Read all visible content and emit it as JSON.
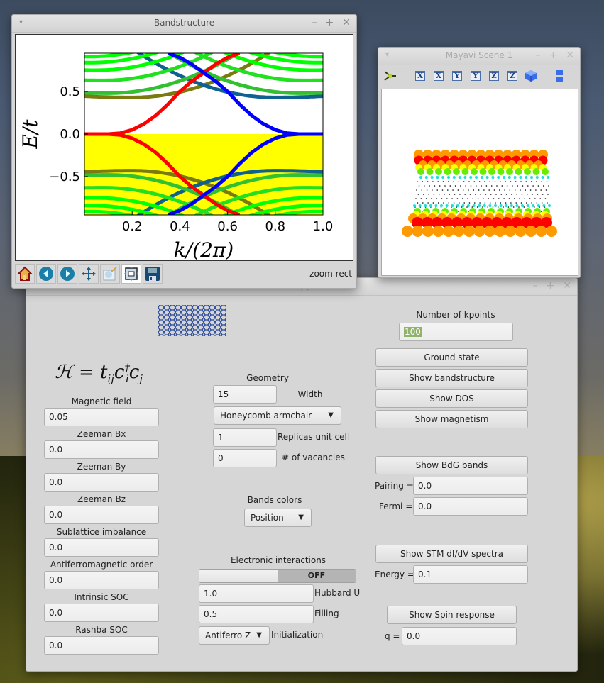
{
  "bandstructure_window": {
    "title": "Bandstructure",
    "controls": {
      "menu": "▾",
      "minimize": "–",
      "maximize": "+",
      "close": "✕"
    },
    "toolbar": [
      {
        "name": "home",
        "icon": "home-icon"
      },
      {
        "name": "back",
        "icon": "back-arrow-icon"
      },
      {
        "name": "forward",
        "icon": "forward-arrow-icon"
      },
      {
        "name": "pan",
        "icon": "move-arrows-icon"
      },
      {
        "name": "zoom",
        "icon": "zoom-rect-icon"
      },
      {
        "name": "configure-subplots",
        "icon": "subplots-icon"
      },
      {
        "name": "save",
        "icon": "floppy-disk-icon"
      }
    ],
    "status": "zoom rect"
  },
  "chart_data": {
    "type": "line",
    "title": "",
    "xlabel": "k/(2π)",
    "ylabel": "E/t",
    "xlim": [
      0.0,
      1.0
    ],
    "ylim": [
      -0.95,
      0.95
    ],
    "xticks": [
      "0.2",
      "0.4",
      "0.6",
      "0.8",
      "1.0"
    ],
    "xtick_values": [
      0.2,
      0.4,
      0.6,
      0.8,
      1.0
    ],
    "yticks": [
      "−0.5",
      "0.0",
      "0.5"
    ],
    "ytick_values": [
      -0.5,
      0.0,
      0.5
    ],
    "occupied_fill": {
      "from": -0.95,
      "to": 0.0,
      "color": "#ffff00"
    },
    "color_scale": {
      "edge_a": "#ff0000",
      "bulk": "#00ff00",
      "edge_b": "#0000ff"
    },
    "series": [
      {
        "name": "edge-state-red",
        "color": "#ff0000",
        "x": [
          0.0,
          0.1,
          0.15,
          0.2,
          0.25,
          0.3,
          0.35,
          0.4,
          0.45,
          0.5,
          0.55,
          0.6,
          0.65
        ],
        "y_upper": [
          0.0,
          0.0,
          0.01,
          0.05,
          0.12,
          0.22,
          0.35,
          0.5,
          0.62,
          0.72,
          0.82,
          0.9,
          0.95
        ],
        "y_lower": [
          0.0,
          0.0,
          -0.01,
          -0.05,
          -0.12,
          -0.22,
          -0.35,
          -0.5,
          -0.62,
          -0.72,
          -0.82,
          -0.9,
          -0.95
        ]
      },
      {
        "name": "edge-state-blue",
        "color": "#0000ff",
        "x": [
          0.35,
          0.4,
          0.45,
          0.5,
          0.55,
          0.6,
          0.65,
          0.7,
          0.75,
          0.8,
          0.85,
          0.9,
          1.0
        ],
        "y_upper": [
          0.95,
          0.9,
          0.82,
          0.72,
          0.62,
          0.5,
          0.35,
          0.22,
          0.12,
          0.05,
          0.01,
          0.0,
          0.0
        ],
        "y_lower": [
          -0.95,
          -0.9,
          -0.82,
          -0.72,
          -0.62,
          -0.5,
          -0.35,
          -0.22,
          -0.12,
          -0.05,
          -0.01,
          0.0,
          0.0
        ]
      },
      {
        "name": "bulk-band-1",
        "color": "#7a7a10",
        "min_gap": 0.43,
        "min_x": [
          0.2,
          0.8
        ]
      },
      {
        "name": "bulk-band-2",
        "color": "#30c030",
        "min_gap": 0.48,
        "min_x": [
          0.1,
          0.9
        ]
      },
      {
        "name": "bulk-band-3",
        "color": "#20e020",
        "min_gap": 0.63,
        "min_x": [
          0.08,
          0.92
        ]
      },
      {
        "name": "bulk-band-4",
        "color": "#00ff00",
        "min_gap": 0.75,
        "min_x": [
          0.05,
          0.95
        ]
      },
      {
        "name": "bulk-band-5",
        "color": "#00ff00",
        "min_gap": 0.84,
        "min_x": [
          0.03,
          0.97
        ]
      },
      {
        "name": "bulk-band-6",
        "color": "#00ff00",
        "min_gap": 0.91,
        "min_x": [
          0.02,
          0.98
        ]
      }
    ],
    "grid": false
  },
  "mayavi_window": {
    "title": "Mayavi Scene 1",
    "controls": {
      "menu": "▾",
      "minimize": "–",
      "maximize": "+",
      "close": "✕"
    },
    "toolbar": [
      {
        "name": "mayavi-logo",
        "icon": "mayavi-icon"
      },
      {
        "name": "view-x-plus",
        "label": "X"
      },
      {
        "name": "view-x-minus",
        "label": "X"
      },
      {
        "name": "view-y-plus",
        "label": "Y"
      },
      {
        "name": "view-y-minus",
        "label": "Y"
      },
      {
        "name": "view-z-plus",
        "label": "Z"
      },
      {
        "name": "view-z-minus",
        "label": "Z"
      },
      {
        "name": "isometric-view",
        "icon": "cube-icon"
      },
      {
        "name": "toggle-axes",
        "icon": "axes-icon"
      }
    ],
    "scene_colors": [
      "#ff9900",
      "#ff0000",
      "#ffff00",
      "#66ee00",
      "#22dddd",
      "#000000"
    ]
  },
  "main_window": {
    "title": "...py",
    "controls": {
      "minimize": "–",
      "maximize": "+",
      "close": "✕"
    },
    "hamiltonian": "ℋ = tᵢⱼc†ᵢcⱼ",
    "left_fields": [
      {
        "label": "Magnetic field",
        "value": "0.05"
      },
      {
        "label": "Zeeman Bx",
        "value": "0.0"
      },
      {
        "label": "Zeeman By",
        "value": "0.0"
      },
      {
        "label": "Zeeman Bz",
        "value": "0.0"
      },
      {
        "label": "Sublattice imbalance",
        "value": "0.0"
      },
      {
        "label": "Antiferromagnetic order",
        "value": "0.0"
      },
      {
        "label": "Intrinsic SOC",
        "value": "0.0"
      },
      {
        "label": "Rashba SOC",
        "value": "0.0"
      }
    ],
    "geometry": {
      "heading": "Geometry",
      "width_value": "15",
      "width_label": "Width",
      "lattice": "Honeycomb armchair",
      "replicas_value": "1",
      "replicas_label": "Replicas unit cell",
      "vacancies_value": "0",
      "vacancies_label": "# of vacancies"
    },
    "bands_colors": {
      "heading": "Bands colors",
      "selected": "Position"
    },
    "interactions": {
      "heading": "Electronic interactions",
      "toggle_state": "OFF",
      "hubbard_value": "1.0",
      "hubbard_label": "Hubbard U",
      "filling_value": "0.5",
      "filling_label": "Filling",
      "init_selected": "Antiferro Z",
      "init_label": "Initialization"
    },
    "kpoints": {
      "label": "Number of kpoints",
      "value": "100"
    },
    "buttons": {
      "ground_state": "Ground state",
      "show_bandstructure": "Show bandstructure",
      "show_dos": "Show DOS",
      "show_magnetism": "Show magnetism",
      "show_bdg": "Show BdG bands",
      "show_stm": "Show STM dI/dV spectra",
      "show_spin": "Show Spin response"
    },
    "bdg": {
      "pairing_label": "Pairing =",
      "pairing_value": "0.0",
      "fermi_label": "Fermi =",
      "fermi_value": "0.0"
    },
    "stm": {
      "energy_label": "Energy =",
      "energy_value": "0.1"
    },
    "spin": {
      "q_label": "q =",
      "q_value": "0.0"
    }
  }
}
